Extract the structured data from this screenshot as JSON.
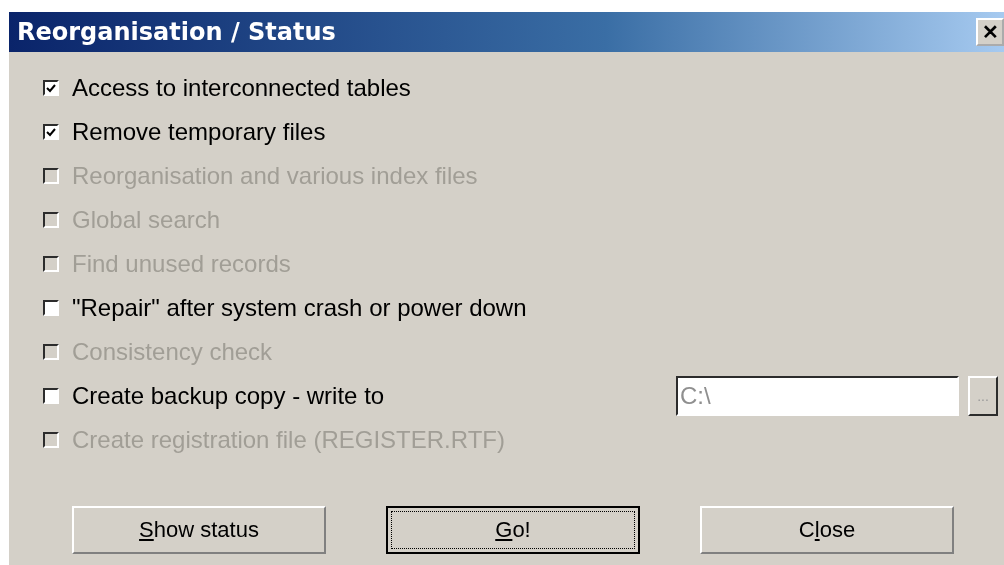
{
  "window": {
    "title": "Reorganisation / Status",
    "close_symbol": "✕"
  },
  "options": [
    {
      "label": "Access to interconnected tables",
      "checked": true,
      "disabled": false
    },
    {
      "label": "Remove temporary files",
      "checked": true,
      "disabled": false
    },
    {
      "label": "Reorganisation and various index files",
      "checked": false,
      "disabled": true
    },
    {
      "label": "Global search",
      "checked": false,
      "disabled": true
    },
    {
      "label": "Find unused records",
      "checked": false,
      "disabled": true
    },
    {
      "label": "\"Repair\" after system crash or power down",
      "checked": false,
      "disabled": false
    },
    {
      "label": "Consistency check",
      "checked": false,
      "disabled": true
    },
    {
      "label": "Create backup copy - write to",
      "checked": false,
      "disabled": false,
      "path": {
        "value": "C:\\",
        "disabled": true,
        "browse": "..."
      }
    },
    {
      "label": "Create registration file (REGISTER.RTF)",
      "checked": false,
      "disabled": true
    }
  ],
  "buttons": [
    {
      "key": "S",
      "after": "how status",
      "focused": false
    },
    {
      "key": "G",
      "after": "o!",
      "focused": true
    },
    {
      "before": "C",
      "key": "l",
      "after": "ose",
      "focused": false
    }
  ]
}
